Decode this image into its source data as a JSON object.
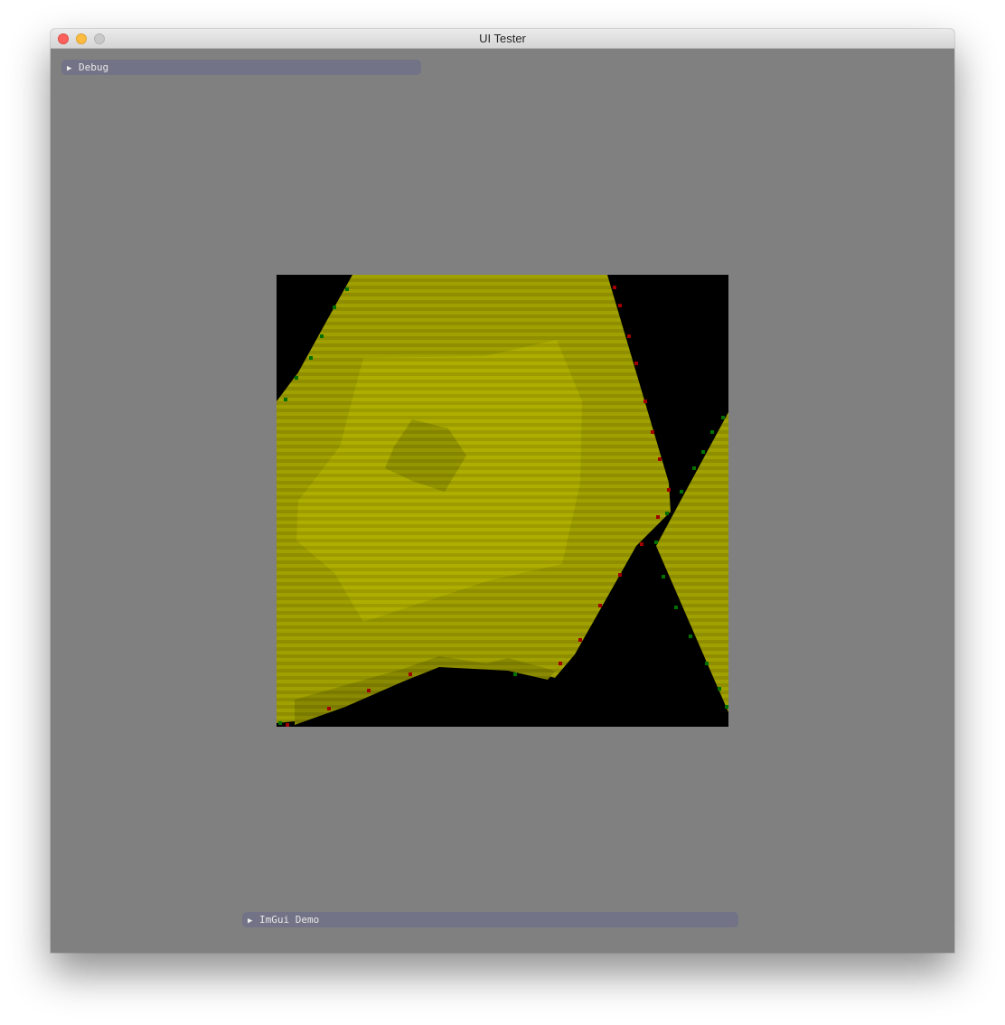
{
  "window": {
    "title": "UI Tester"
  },
  "panels": {
    "debug": {
      "label": "Debug",
      "collapsed": true
    },
    "imgui_demo": {
      "label": "ImGui Demo",
      "collapsed": true
    }
  },
  "colors": {
    "window_background": "#808080",
    "collapsing_header": "#737387",
    "render_fill": "#a0a000",
    "render_background": "#000000"
  },
  "icons": {
    "close": "close-traffic-light-icon",
    "minimize": "minimize-traffic-light-icon",
    "zoom": "zoom-traffic-light-icon",
    "arrow": "arrow-right-icon"
  }
}
